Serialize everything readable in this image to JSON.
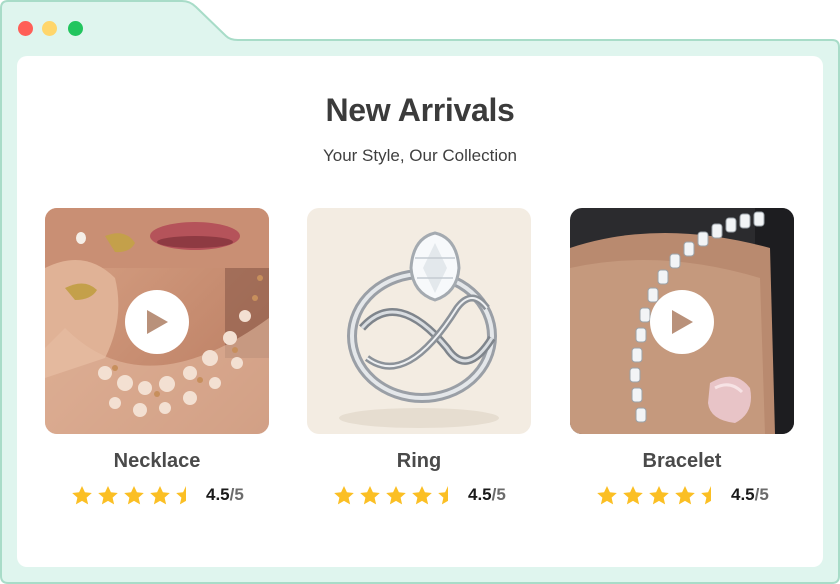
{
  "window": {
    "controls": [
      "close",
      "minimize",
      "maximize"
    ],
    "frame_color": "#dff5ee",
    "frame_border": "#a8dcc8"
  },
  "header": {
    "title": "New Arrivals",
    "subtitle": "Your Style, Our Collection"
  },
  "products": [
    {
      "name": "Necklace",
      "rating": "4.5",
      "rating_max": "/5",
      "stars_value": 4.5,
      "has_video": true,
      "image": "necklace-photo"
    },
    {
      "name": "Ring",
      "rating": "4.5",
      "rating_max": "/5",
      "stars_value": 4.5,
      "has_video": false,
      "image": "ring-photo"
    },
    {
      "name": "Bracelet",
      "rating": "4.5",
      "rating_max": "/5",
      "stars_value": 4.5,
      "has_video": true,
      "image": "bracelet-photo"
    }
  ],
  "colors": {
    "star": "#fbbf24",
    "play_icon": "#b9917a",
    "title": "#3b3b3b"
  }
}
